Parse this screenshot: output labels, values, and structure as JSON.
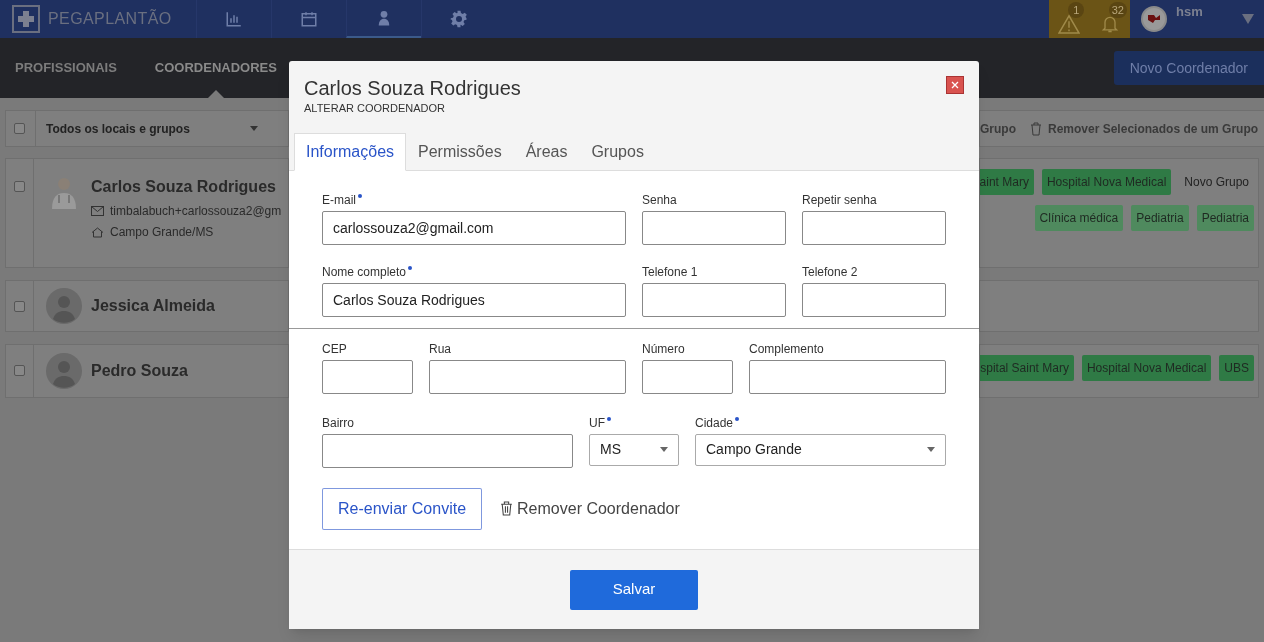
{
  "header": {
    "brand": "PEGAPLANTÃO",
    "nav": [
      {
        "kind": "chart",
        "selected": false
      },
      {
        "kind": "calendar",
        "selected": false
      },
      {
        "kind": "person",
        "selected": true
      },
      {
        "kind": "gear",
        "selected": false
      }
    ],
    "alerts": [
      {
        "kind": "warning",
        "count": "1"
      },
      {
        "kind": "bell",
        "count": "32"
      }
    ],
    "user": "hsm"
  },
  "subnav": {
    "tabs": [
      {
        "label": "PROFISSIONAIS",
        "selected": false
      },
      {
        "label": "COORDENADORES",
        "selected": true
      }
    ],
    "new_button": "Novo Coordenador"
  },
  "toolbar": {
    "checked": false,
    "filter": "Todos os locais e grupos",
    "add_group": "Grupo",
    "remove_group": "Remover Selecionados de um Grupo"
  },
  "people": [
    {
      "name": "Carlos Souza Rodrigues",
      "checked": false,
      "photo": true,
      "email": "timbalabuch+carlossouza2@gm",
      "city": "Campo Grande/MS",
      "tags": [
        {
          "label": "aint Mary",
          "kind": "place"
        },
        {
          "label": "Hospital Nova Medical",
          "kind": "place"
        },
        {
          "label": "Novo Grupo",
          "kind": "group"
        }
      ],
      "areas": [
        {
          "label": "Clínica médica"
        },
        {
          "label": "Pediatria"
        },
        {
          "label": "Pediatria"
        }
      ]
    },
    {
      "name": "Jessica Almeida",
      "checked": false,
      "photo": false
    },
    {
      "name": "Pedro Souza",
      "checked": false,
      "photo": false,
      "tags": [
        {
          "label": "spital Saint Mary",
          "kind": "place"
        },
        {
          "label": "Hospital Nova Medical",
          "kind": "place"
        },
        {
          "label": "UBS",
          "kind": "place"
        }
      ]
    }
  ],
  "modal": {
    "title": "Carlos Souza Rodrigues",
    "subtitle": "ALTERAR COORDENADOR",
    "tabs": [
      {
        "label": "Informações",
        "selected": true
      },
      {
        "label": "Permissões",
        "selected": false
      },
      {
        "label": "Áreas",
        "selected": false
      },
      {
        "label": "Grupos",
        "selected": false
      }
    ],
    "account_fields": [
      {
        "label": "E-mail",
        "required": true,
        "value": "carlossouza2@gmail.com",
        "kind": "text"
      },
      {
        "label": "Senha",
        "required": false,
        "kind": "text"
      },
      {
        "label": "Repetir senha",
        "required": false,
        "kind": "text"
      },
      {
        "label": "Nome completo",
        "required": true,
        "value": "Carlos Souza Rodrigues",
        "kind": "text"
      },
      {
        "label": "Telefone 1",
        "required": false,
        "kind": "text"
      },
      {
        "label": "Telefone 2",
        "required": false,
        "kind": "text"
      }
    ],
    "address_row1": [
      {
        "label": "CEP",
        "required": false,
        "kind": "text"
      },
      {
        "label": "Rua",
        "required": false,
        "kind": "text"
      },
      {
        "label": "Número",
        "required": false,
        "kind": "text"
      },
      {
        "label": "Complemento",
        "required": false,
        "kind": "text"
      }
    ],
    "address_row2": [
      {
        "label": "Bairro",
        "required": false,
        "kind": "text"
      },
      {
        "label": "UF",
        "required": true,
        "value": "MS",
        "kind": "select"
      },
      {
        "label": "Cidade",
        "required": true,
        "value": "Campo Grande",
        "kind": "select"
      }
    ],
    "resend_button": "Re-enviar Convite",
    "remove_button": "Remover Coordenador",
    "save_button": "Salvar"
  }
}
